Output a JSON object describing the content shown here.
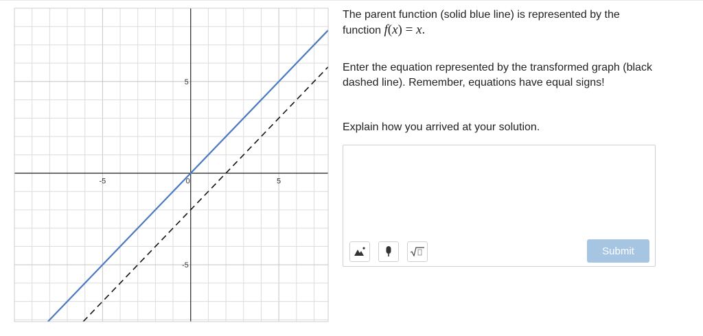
{
  "graph": {
    "x_range": [
      -10,
      7.8
    ],
    "y_range": [
      -8.1,
      9.0
    ],
    "grid_step": 1,
    "tick_labels": [
      {
        "axis": "x",
        "value": -5,
        "text": "-5"
      },
      {
        "axis": "x",
        "value": 0,
        "text": "0"
      },
      {
        "axis": "x",
        "value": 5,
        "text": "5"
      },
      {
        "axis": "y",
        "value": 5,
        "text": "5"
      },
      {
        "axis": "y",
        "value": -5,
        "text": "-5"
      }
    ],
    "parent_line": {
      "slope": 1,
      "intercept": 0,
      "color": "#4a79c0",
      "style": "solid"
    },
    "transformed_line": {
      "slope": 1,
      "intercept": -2,
      "color": "#111111",
      "style": "dashed"
    },
    "colors": {
      "grid": "#dcdcdc",
      "axis": "#222222",
      "frame": "#cccccc"
    }
  },
  "question": {
    "prompt1_text": "The parent function (solid blue line) is represented by the function ",
    "math_f": "f",
    "math_paren_open": "(",
    "math_x": "x",
    "math_paren_close": ")",
    "math_eq": " = ",
    "math_rhs": "x",
    "math_period": ".",
    "prompt2": "Enter the equation represented by the transformed graph (black dashed line).  Remember, equations have equal signs!",
    "prompt3": "Explain how you arrived at your solution."
  },
  "answer": {
    "value": "",
    "tools": [
      "image-icon",
      "microphone-icon",
      "square-root-icon"
    ],
    "submit_label": "Submit",
    "submit_color": "#a5c5e3"
  }
}
